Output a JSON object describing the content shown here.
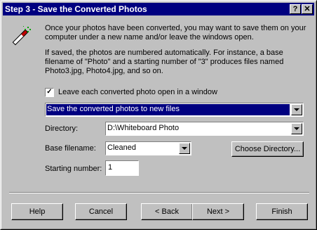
{
  "window": {
    "title": "Step 3 - Save the Converted Photos"
  },
  "titlebar": {
    "help_glyph": "?",
    "close_glyph": "✕"
  },
  "icon": {
    "name": "magic-wand-icon"
  },
  "intro_text": "Once your photos have been converted, you may want to save them on your computer under a new name and/or leave the windows open.",
  "note_text": "If saved, the photos are numbered automatically. For instance, a base filename of \"Photo\" and a starting number of \"3\" produces files named Photo3.jpg, Photo4.jpg, and so on.",
  "leave_open": {
    "label": "Leave each converted photo open in a window",
    "checked": true
  },
  "save_mode": {
    "selected": "Save the converted photos to new files"
  },
  "directory": {
    "label": "Directory:",
    "value": "D:\\Whiteboard Photo"
  },
  "base_filename": {
    "label": "Base filename:",
    "value": "Cleaned"
  },
  "choose_directory": {
    "label": "Choose Directory..."
  },
  "starting_number": {
    "label": "Starting number:",
    "value": "1"
  },
  "buttons": {
    "help": "Help",
    "cancel": "Cancel",
    "back": "< Back",
    "next": "Next >",
    "finish": "Finish"
  },
  "colors": {
    "titlebar": "#000080",
    "face": "#c0c0c0",
    "selection": "#000080"
  }
}
